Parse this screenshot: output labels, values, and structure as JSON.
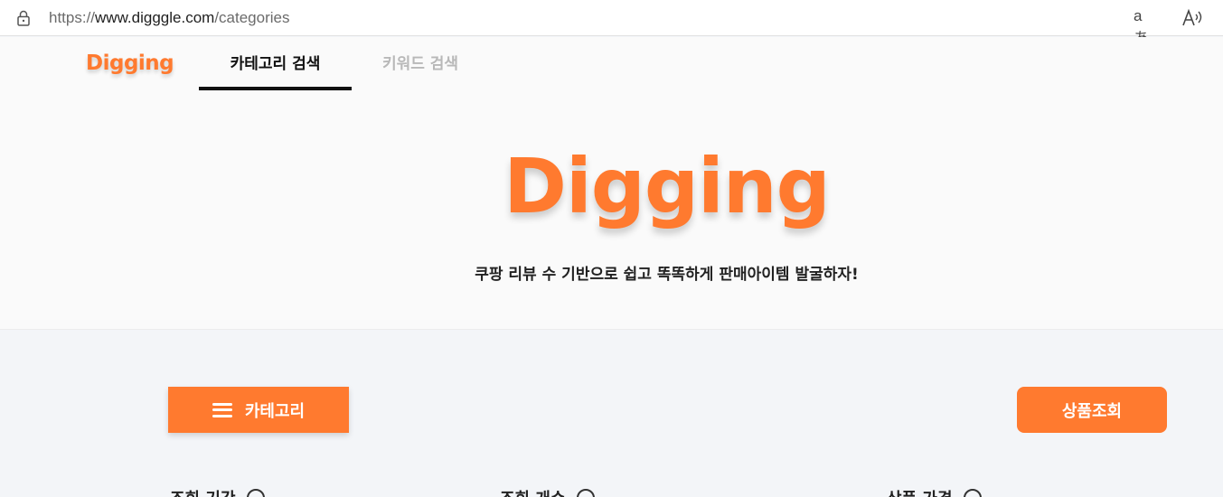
{
  "browser": {
    "url_scheme": "https://",
    "url_host": "www.digggle.com",
    "url_path": "/categories",
    "translate_label": "aあ",
    "read_aloud_label": "A⁾"
  },
  "header": {
    "logo": "Digging",
    "tabs": [
      {
        "label": "카테고리 검색",
        "active": true
      },
      {
        "label": "키워드 검색",
        "active": false
      }
    ]
  },
  "hero": {
    "title": "Digging",
    "tagline": "쿠팡 리뷰 수 기반으로 쉽고 똑똑하게 판매아이템 발굴하자!"
  },
  "actions": {
    "category_button": "카테고리",
    "search_button": "상품조회"
  },
  "filters": [
    {
      "label": "조회 기간"
    },
    {
      "label": "조회 개수"
    },
    {
      "label": "상품 가격"
    }
  ],
  "colors": {
    "brand": "#ff7a2f",
    "active_tab": "#111111",
    "inactive_tab": "#b8b8b8"
  }
}
